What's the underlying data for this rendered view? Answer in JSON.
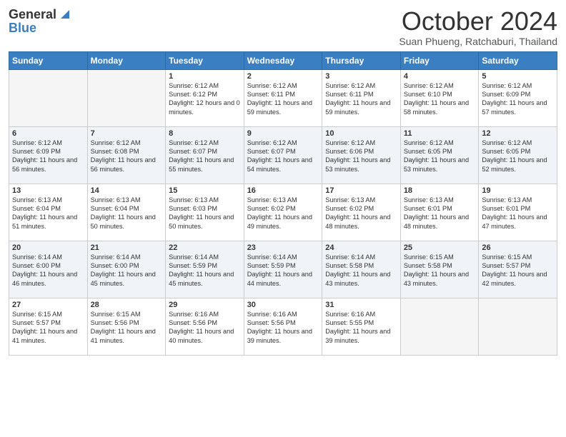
{
  "header": {
    "logo_general": "General",
    "logo_blue": "Blue",
    "month_title": "October 2024",
    "subtitle": "Suan Phueng, Ratchaburi, Thailand"
  },
  "days_of_week": [
    "Sunday",
    "Monday",
    "Tuesday",
    "Wednesday",
    "Thursday",
    "Friday",
    "Saturday"
  ],
  "weeks": [
    [
      {
        "day": "",
        "info": ""
      },
      {
        "day": "",
        "info": ""
      },
      {
        "day": "1",
        "info": "Sunrise: 6:12 AM\nSunset: 6:12 PM\nDaylight: 12 hours and 0 minutes."
      },
      {
        "day": "2",
        "info": "Sunrise: 6:12 AM\nSunset: 6:11 PM\nDaylight: 11 hours and 59 minutes."
      },
      {
        "day": "3",
        "info": "Sunrise: 6:12 AM\nSunset: 6:11 PM\nDaylight: 11 hours and 59 minutes."
      },
      {
        "day": "4",
        "info": "Sunrise: 6:12 AM\nSunset: 6:10 PM\nDaylight: 11 hours and 58 minutes."
      },
      {
        "day": "5",
        "info": "Sunrise: 6:12 AM\nSunset: 6:09 PM\nDaylight: 11 hours and 57 minutes."
      }
    ],
    [
      {
        "day": "6",
        "info": "Sunrise: 6:12 AM\nSunset: 6:09 PM\nDaylight: 11 hours and 56 minutes."
      },
      {
        "day": "7",
        "info": "Sunrise: 6:12 AM\nSunset: 6:08 PM\nDaylight: 11 hours and 56 minutes."
      },
      {
        "day": "8",
        "info": "Sunrise: 6:12 AM\nSunset: 6:07 PM\nDaylight: 11 hours and 55 minutes."
      },
      {
        "day": "9",
        "info": "Sunrise: 6:12 AM\nSunset: 6:07 PM\nDaylight: 11 hours and 54 minutes."
      },
      {
        "day": "10",
        "info": "Sunrise: 6:12 AM\nSunset: 6:06 PM\nDaylight: 11 hours and 53 minutes."
      },
      {
        "day": "11",
        "info": "Sunrise: 6:12 AM\nSunset: 6:05 PM\nDaylight: 11 hours and 53 minutes."
      },
      {
        "day": "12",
        "info": "Sunrise: 6:12 AM\nSunset: 6:05 PM\nDaylight: 11 hours and 52 minutes."
      }
    ],
    [
      {
        "day": "13",
        "info": "Sunrise: 6:13 AM\nSunset: 6:04 PM\nDaylight: 11 hours and 51 minutes."
      },
      {
        "day": "14",
        "info": "Sunrise: 6:13 AM\nSunset: 6:04 PM\nDaylight: 11 hours and 50 minutes."
      },
      {
        "day": "15",
        "info": "Sunrise: 6:13 AM\nSunset: 6:03 PM\nDaylight: 11 hours and 50 minutes."
      },
      {
        "day": "16",
        "info": "Sunrise: 6:13 AM\nSunset: 6:02 PM\nDaylight: 11 hours and 49 minutes."
      },
      {
        "day": "17",
        "info": "Sunrise: 6:13 AM\nSunset: 6:02 PM\nDaylight: 11 hours and 48 minutes."
      },
      {
        "day": "18",
        "info": "Sunrise: 6:13 AM\nSunset: 6:01 PM\nDaylight: 11 hours and 48 minutes."
      },
      {
        "day": "19",
        "info": "Sunrise: 6:13 AM\nSunset: 6:01 PM\nDaylight: 11 hours and 47 minutes."
      }
    ],
    [
      {
        "day": "20",
        "info": "Sunrise: 6:14 AM\nSunset: 6:00 PM\nDaylight: 11 hours and 46 minutes."
      },
      {
        "day": "21",
        "info": "Sunrise: 6:14 AM\nSunset: 6:00 PM\nDaylight: 11 hours and 45 minutes."
      },
      {
        "day": "22",
        "info": "Sunrise: 6:14 AM\nSunset: 5:59 PM\nDaylight: 11 hours and 45 minutes."
      },
      {
        "day": "23",
        "info": "Sunrise: 6:14 AM\nSunset: 5:59 PM\nDaylight: 11 hours and 44 minutes."
      },
      {
        "day": "24",
        "info": "Sunrise: 6:14 AM\nSunset: 5:58 PM\nDaylight: 11 hours and 43 minutes."
      },
      {
        "day": "25",
        "info": "Sunrise: 6:15 AM\nSunset: 5:58 PM\nDaylight: 11 hours and 43 minutes."
      },
      {
        "day": "26",
        "info": "Sunrise: 6:15 AM\nSunset: 5:57 PM\nDaylight: 11 hours and 42 minutes."
      }
    ],
    [
      {
        "day": "27",
        "info": "Sunrise: 6:15 AM\nSunset: 5:57 PM\nDaylight: 11 hours and 41 minutes."
      },
      {
        "day": "28",
        "info": "Sunrise: 6:15 AM\nSunset: 5:56 PM\nDaylight: 11 hours and 41 minutes."
      },
      {
        "day": "29",
        "info": "Sunrise: 6:16 AM\nSunset: 5:56 PM\nDaylight: 11 hours and 40 minutes."
      },
      {
        "day": "30",
        "info": "Sunrise: 6:16 AM\nSunset: 5:56 PM\nDaylight: 11 hours and 39 minutes."
      },
      {
        "day": "31",
        "info": "Sunrise: 6:16 AM\nSunset: 5:55 PM\nDaylight: 11 hours and 39 minutes."
      },
      {
        "day": "",
        "info": ""
      },
      {
        "day": "",
        "info": ""
      }
    ]
  ]
}
